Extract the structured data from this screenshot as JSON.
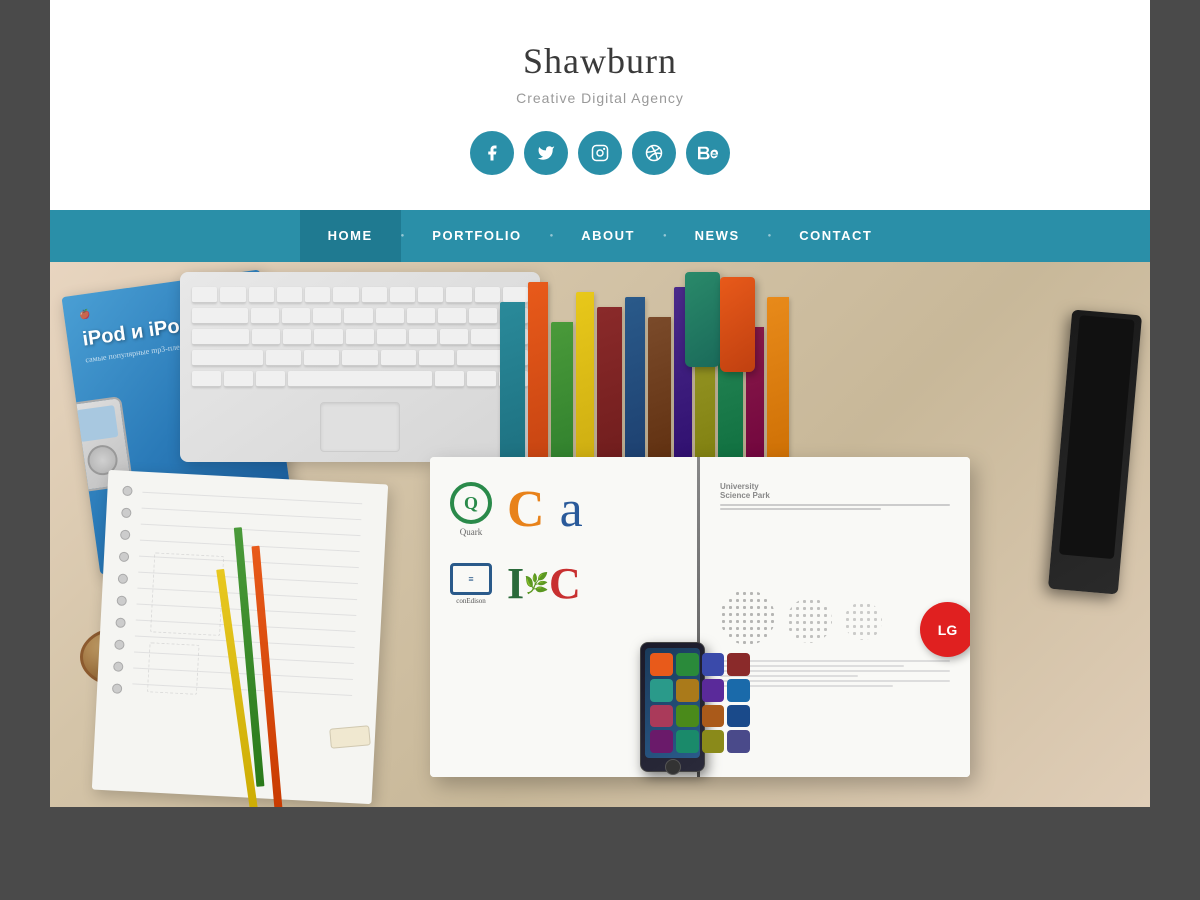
{
  "site": {
    "title": "Shawburn",
    "tagline": "Creative Digital Agency",
    "background_color": "#4a4a4a"
  },
  "social_icons": [
    {
      "name": "facebook",
      "symbol": "f",
      "label": "Facebook"
    },
    {
      "name": "twitter",
      "symbol": "t",
      "label": "Twitter"
    },
    {
      "name": "instagram",
      "symbol": "ig",
      "label": "Instagram"
    },
    {
      "name": "dribbble",
      "symbol": "dr",
      "label": "Dribbble"
    },
    {
      "name": "behance",
      "symbol": "Be",
      "label": "Behance"
    }
  ],
  "nav": {
    "items": [
      {
        "label": "HOME",
        "active": true
      },
      {
        "label": "PORTFOLIO",
        "active": false
      },
      {
        "label": "ABOUT",
        "active": false
      },
      {
        "label": "NEWS",
        "active": false
      },
      {
        "label": "CONTACT",
        "active": false
      }
    ],
    "accent_color": "#2a8fa8",
    "active_color": "#1f7a91"
  },
  "hero": {
    "alt_text": "Creative agency desk workspace with laptop, books, pencils, and design materials"
  }
}
